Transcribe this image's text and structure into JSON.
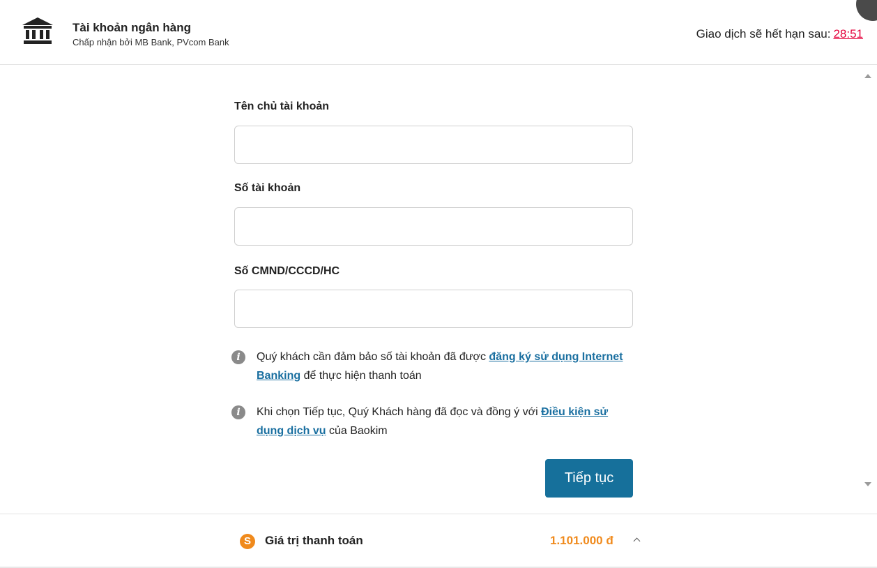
{
  "header": {
    "title": "Tài khoản ngân hàng",
    "subtitle": "Chấp nhận bởi MB Bank, PVcom Bank",
    "expiry_label": "Giao dịch sẽ hết hạn sau:",
    "expiry_timer": "28:51",
    "icon": "bank-icon"
  },
  "form": {
    "account_holder_label": "Tên chủ tài khoản",
    "account_holder_value": "",
    "account_number_label": "Số tài khoản",
    "account_number_value": "",
    "id_number_label": "Số CMND/CCCD/HC",
    "id_number_value": ""
  },
  "notes": {
    "note1_prefix": "Quý khách cần đảm bảo số tài khoản đã được ",
    "note1_link": "đăng ký sử dụng Internet Banking",
    "note1_suffix": " để thực hiện thanh toán",
    "note2_prefix": "Khi chọn Tiếp tục, Quý Khách hàng đã đọc và đồng ý với ",
    "note2_link": "Điều kiện sử dụng dịch vụ",
    "note2_suffix": " của Baokim"
  },
  "actions": {
    "continue_label": "Tiếp tục"
  },
  "footer": {
    "payment_label": "Giá trị thanh toán",
    "payment_amount": "1.101.000 đ",
    "coin_symbol": "S"
  },
  "colors": {
    "accent": "#16709b",
    "timer": "#e4003a",
    "amount": "#f08a1c",
    "link": "#1a6fa0"
  }
}
